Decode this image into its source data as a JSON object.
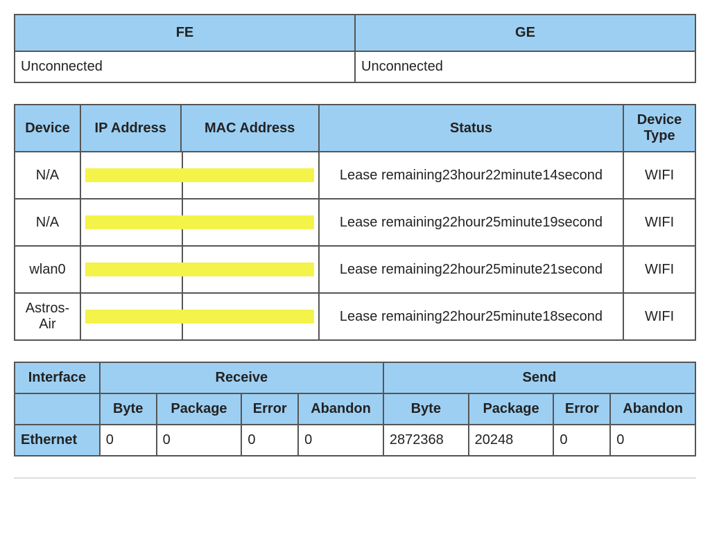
{
  "connection": {
    "headers": {
      "fe": "FE",
      "ge": "GE"
    },
    "values": {
      "fe": "Unconnected",
      "ge": "Unconnected"
    }
  },
  "devices": {
    "headers": {
      "device": "Device",
      "ip": "IP Address",
      "mac": "MAC Address",
      "status": "Status",
      "type": "Device Type"
    },
    "rows": [
      {
        "device": "N/A",
        "ip": "",
        "mac": "",
        "status": "Lease remaining23hour22minute14second",
        "type": "WIFI",
        "redacted": true
      },
      {
        "device": "N/A",
        "ip": "",
        "mac": "",
        "status": "Lease remaining22hour25minute19second",
        "type": "WIFI",
        "redacted": true
      },
      {
        "device": "wlan0",
        "ip": "",
        "mac": "",
        "status": "Lease remaining22hour25minute21second",
        "type": "WIFI",
        "redacted": true
      },
      {
        "device": "Astros-Air",
        "ip": "",
        "mac": "",
        "status": "Lease remaining22hour25minute18second",
        "type": "WIFI",
        "redacted": true
      }
    ]
  },
  "stats": {
    "headers": {
      "interface": "Interface",
      "receive": "Receive",
      "send": "Send",
      "byte": "Byte",
      "package": "Package",
      "error": "Error",
      "abandon": "Abandon"
    },
    "rows": [
      {
        "interface": "Ethernet",
        "recv": {
          "byte": "0",
          "package": "0",
          "error": "0",
          "abandon": "0"
        },
        "send": {
          "byte": "2872368",
          "package": "20248",
          "error": "0",
          "abandon": "0"
        }
      }
    ]
  }
}
